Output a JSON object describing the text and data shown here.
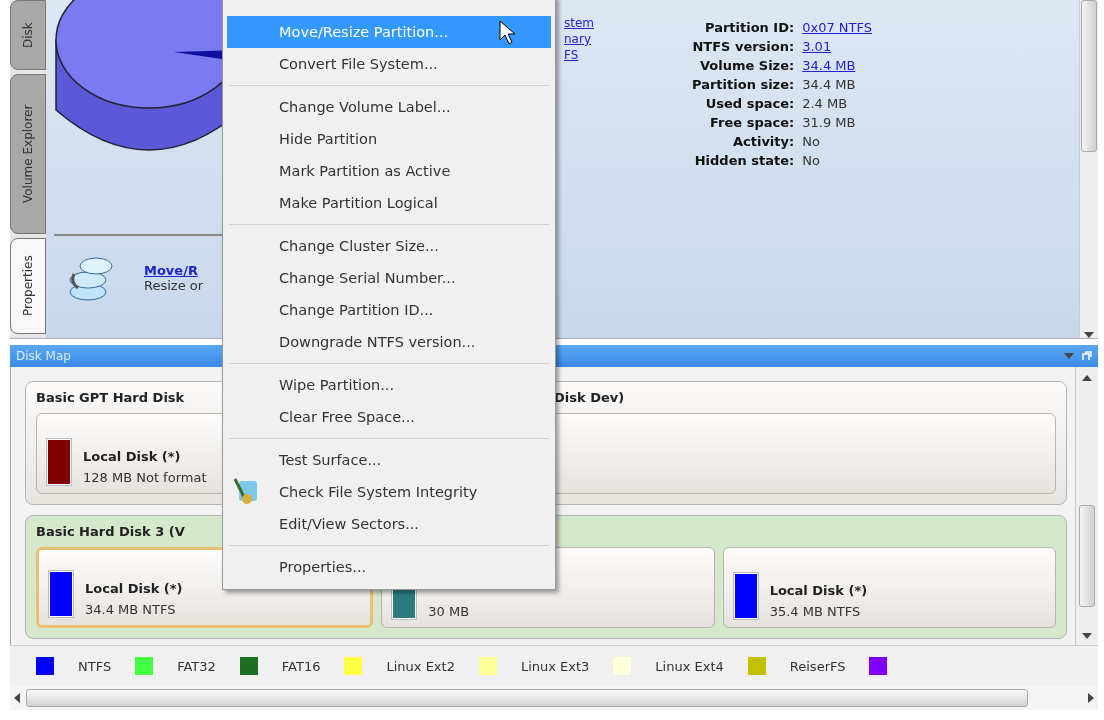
{
  "side_tabs": [
    {
      "label": "Disk",
      "selected": false
    },
    {
      "label": "Volume Explorer",
      "selected": false
    },
    {
      "label": "Properties",
      "selected": true
    }
  ],
  "action": {
    "link": "Move/R",
    "description": "Resize or"
  },
  "partial_links": [
    "stem",
    "nary",
    "FS"
  ],
  "properties": [
    {
      "label": "Partition ID:",
      "value": "0x07 NTFS",
      "kind": "link"
    },
    {
      "label": "NTFS version:",
      "value": "3.01",
      "kind": "link"
    },
    {
      "label": "Volume Size:",
      "value": "34.4 MB",
      "kind": "link"
    },
    {
      "label": "Partition size:",
      "value": "34.4 MB",
      "kind": "text"
    },
    {
      "label": "Used space:",
      "value": "2.4 MB",
      "kind": "text"
    },
    {
      "label": "Free space:",
      "value": "31.9 MB",
      "kind": "text"
    },
    {
      "label": "Activity:",
      "value": "No",
      "kind": "text"
    },
    {
      "label": "Hidden state:",
      "value": "No",
      "kind": "text"
    }
  ],
  "disk_map": {
    "title": "Disk Map",
    "disks": [
      {
        "title": "Basic GPT Hard Disk",
        "title_tail": "Disk Dev)",
        "kind": "gpt",
        "partitions": [
          {
            "name": "Local Disk (*)",
            "info": "128 MB Not format",
            "color": "#800000",
            "selected": false
          },
          {
            "selected": false
          }
        ]
      },
      {
        "title": "Basic Hard Disk 3 (V",
        "kind": "mbr",
        "partitions": [
          {
            "name": "Local Disk (*)",
            "info": "34.4 MB NTFS",
            "color": "#0000ff",
            "selected": true
          },
          {
            "info": "30 MB",
            "color": "#2a7a80",
            "selected": false
          },
          {
            "name": "Local Disk (*)",
            "info": "35.4 MB NTFS",
            "color": "#0000ff",
            "selected": false
          }
        ]
      }
    ]
  },
  "legend": [
    {
      "label": "NTFS",
      "color": "#0000ff"
    },
    {
      "label": "FAT32",
      "color": "#44ff44"
    },
    {
      "label": "FAT16",
      "color": "#1f6f22"
    },
    {
      "label": "Linux Ext2",
      "color": "#ffff44"
    },
    {
      "label": "Linux Ext3",
      "color": "#ffff99"
    },
    {
      "label": "Linux Ext4",
      "color": "#ffffd9"
    },
    {
      "label": "ReiserFS",
      "color": "#c2c000"
    },
    {
      "color": "#8000ff"
    }
  ],
  "context_menu": [
    [
      {
        "label": "Move/Resize Partition...",
        "selected": true,
        "icon": false
      },
      {
        "label": "Convert File System...",
        "selected": false,
        "icon": false
      }
    ],
    [
      {
        "label": "Change Volume Label...",
        "selected": false,
        "icon": false
      },
      {
        "label": "Hide Partition",
        "selected": false,
        "icon": false
      },
      {
        "label": "Mark Partition as Active",
        "selected": false,
        "icon": false
      },
      {
        "label": "Make Partition Logical",
        "selected": false,
        "icon": false
      }
    ],
    [
      {
        "label": "Change Cluster Size...",
        "selected": false,
        "icon": false
      },
      {
        "label": "Change Serial Number...",
        "selected": false,
        "icon": false
      },
      {
        "label": "Change Partition ID...",
        "selected": false,
        "icon": false
      },
      {
        "label": "Downgrade NTFS version...",
        "selected": false,
        "icon": false
      }
    ],
    [
      {
        "label": "Wipe Partition...",
        "selected": false,
        "icon": false
      },
      {
        "label": "Clear Free Space...",
        "selected": false,
        "icon": false
      }
    ],
    [
      {
        "label": "Test Surface...",
        "selected": false,
        "icon": false
      },
      {
        "label": "Check File System Integrity",
        "selected": false,
        "icon": true
      },
      {
        "label": "Edit/View Sectors...",
        "selected": false,
        "icon": false
      }
    ],
    [
      {
        "label": "Properties...",
        "selected": false,
        "icon": false
      }
    ]
  ]
}
